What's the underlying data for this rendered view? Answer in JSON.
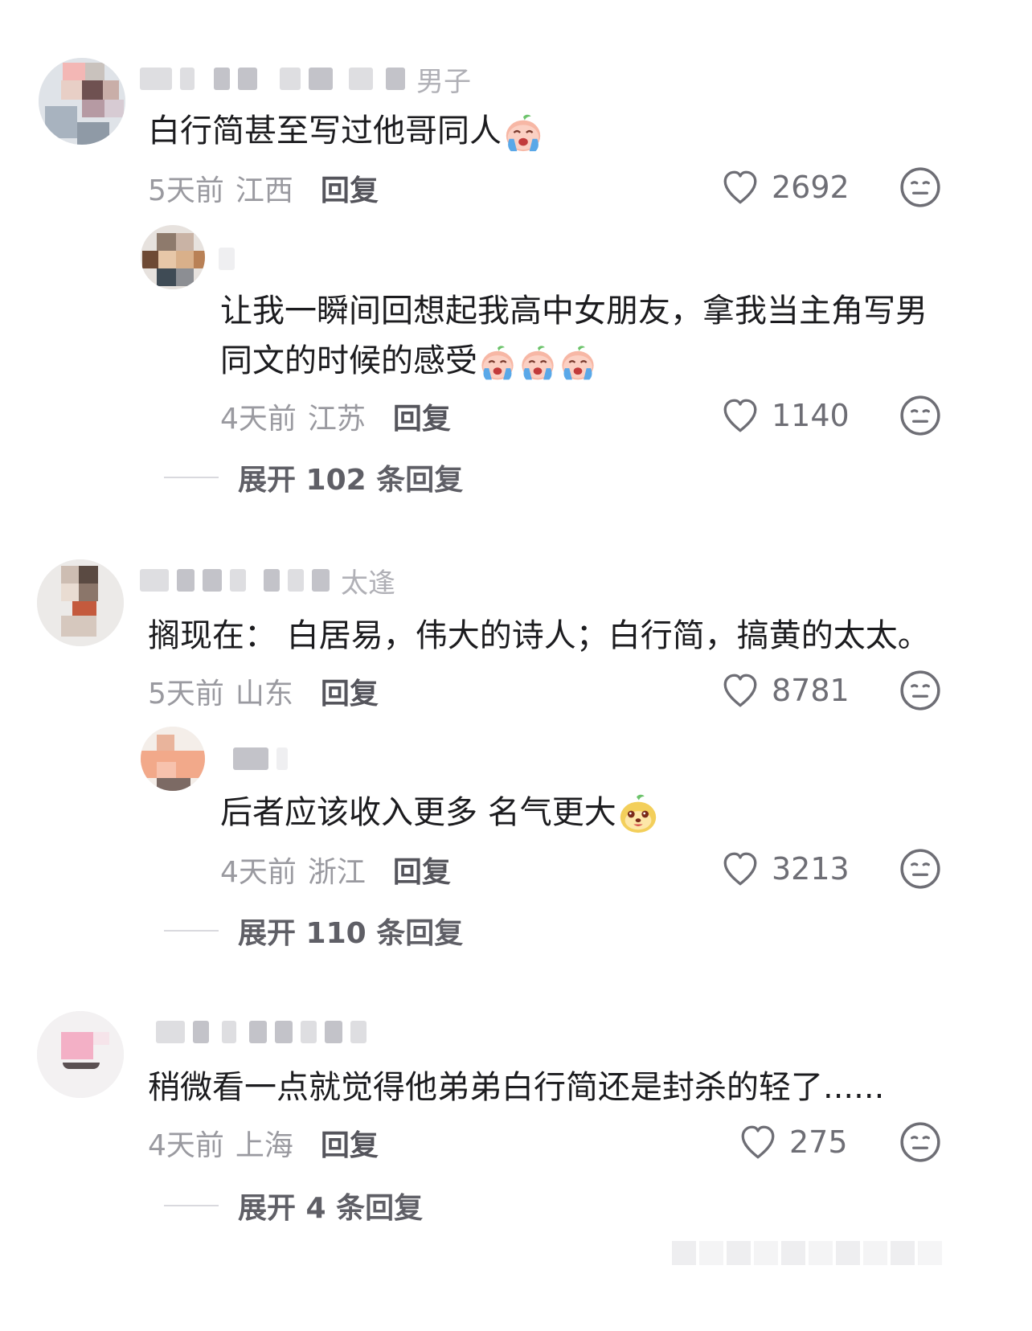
{
  "comments": [
    {
      "username_tail": "男子",
      "text": "白行简甚至写过他哥同人",
      "time": "5天前",
      "location": "江西",
      "reply_label": "回复",
      "likes": "2692",
      "replies": [
        {
          "text": "让我一瞬间回想起我高中女朋友，拿我当主角写男同文的时候的感受",
          "time": "4天前",
          "location": "江苏",
          "reply_label": "回复",
          "likes": "1140"
        }
      ],
      "expand_label": "展开 102 条回复"
    },
    {
      "username_tail": "太逢",
      "text": "搁现在： 白居易，伟大的诗人；白行简，搞黄的太太。",
      "time": "5天前",
      "location": "山东",
      "reply_label": "回复",
      "likes": "8781",
      "replies": [
        {
          "text": "后者应该收入更多 名气更大",
          "time": "4天前",
          "location": "浙江",
          "reply_label": "回复",
          "likes": "3213"
        }
      ],
      "expand_label": "展开 110 条回复"
    },
    {
      "username_tail": "",
      "text": "稍微看一点就觉得他弟弟白行简还是封杀的轻了......",
      "time": "4天前",
      "location": "上海",
      "reply_label": "回复",
      "likes": "275",
      "replies": [],
      "expand_label": "展开 4 条回复"
    }
  ],
  "icons": {
    "like": "heart-outline-icon",
    "dislike": "neutral-face-icon",
    "emoji_cry": "crying-peach-emoji",
    "emoji_dog": "yellow-dog-emoji"
  },
  "colors": {
    "text": "#1c1c1f",
    "meta": "#9a9aa0",
    "icon": "#6e6e75",
    "divider": "#d9d9de"
  }
}
